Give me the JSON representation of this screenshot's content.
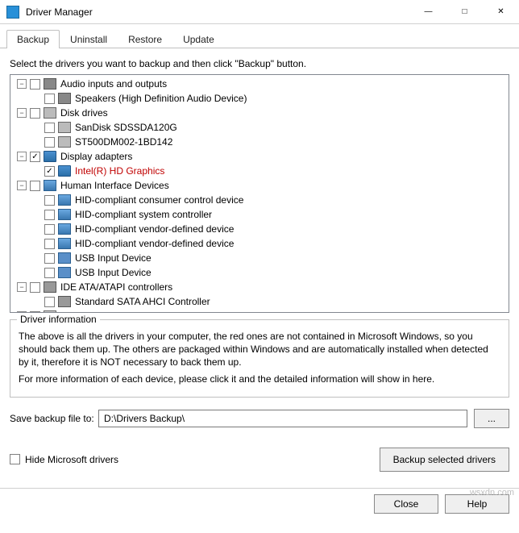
{
  "title": "Driver Manager",
  "tabs": [
    "Backup",
    "Uninstall",
    "Restore",
    "Update"
  ],
  "active_tab": 0,
  "instruction": "Select the drivers you want to backup and then click \"Backup\" button.",
  "tree": [
    {
      "level": 0,
      "expander": "-",
      "checked": false,
      "icon": "speaker",
      "label": "Audio inputs and outputs"
    },
    {
      "level": 1,
      "expander": "",
      "checked": false,
      "icon": "speaker",
      "label": "Speakers (High Definition Audio Device)"
    },
    {
      "level": 0,
      "expander": "-",
      "checked": false,
      "icon": "disk",
      "label": "Disk drives"
    },
    {
      "level": 1,
      "expander": "",
      "checked": false,
      "icon": "disk",
      "label": "SanDisk SDSSDA120G"
    },
    {
      "level": 1,
      "expander": "",
      "checked": false,
      "icon": "disk",
      "label": "ST500DM002-1BD142"
    },
    {
      "level": 0,
      "expander": "-",
      "checked": true,
      "icon": "monitor",
      "label": "Display adapters"
    },
    {
      "level": 1,
      "expander": "",
      "checked": true,
      "icon": "monitor",
      "label": "Intel(R) HD Graphics",
      "red": true
    },
    {
      "level": 0,
      "expander": "-",
      "checked": false,
      "icon": "hid",
      "label": "Human Interface Devices"
    },
    {
      "level": 1,
      "expander": "",
      "checked": false,
      "icon": "hid",
      "label": "HID-compliant consumer control device"
    },
    {
      "level": 1,
      "expander": "",
      "checked": false,
      "icon": "hid",
      "label": "HID-compliant system controller"
    },
    {
      "level": 1,
      "expander": "",
      "checked": false,
      "icon": "hid",
      "label": "HID-compliant vendor-defined device"
    },
    {
      "level": 1,
      "expander": "",
      "checked": false,
      "icon": "hid",
      "label": "HID-compliant vendor-defined device"
    },
    {
      "level": 1,
      "expander": "",
      "checked": false,
      "icon": "usb",
      "label": "USB Input Device"
    },
    {
      "level": 1,
      "expander": "",
      "checked": false,
      "icon": "usb",
      "label": "USB Input Device"
    },
    {
      "level": 0,
      "expander": "-",
      "checked": false,
      "icon": "ide",
      "label": "IDE ATA/ATAPI controllers"
    },
    {
      "level": 1,
      "expander": "",
      "checked": false,
      "icon": "ide",
      "label": "Standard SATA AHCI Controller"
    },
    {
      "level": 0,
      "expander": "-",
      "checked": false,
      "icon": "keyboard",
      "label": "Keyboards"
    }
  ],
  "info": {
    "legend": "Driver information",
    "para1": "The above is all the drivers in your computer, the red ones are not contained in Microsoft Windows, so you should back them up. The others are packaged within Windows and are automatically installed when detected by it, therefore it is NOT necessary to back them up.",
    "para2": "For more information of each device, please click it and the detailed information will show in here."
  },
  "save_label": "Save backup file to:",
  "save_path": "D:\\Drivers Backup\\",
  "browse_label": "...",
  "hide_label": "Hide Microsoft drivers",
  "backup_button": "Backup selected drivers",
  "close_button": "Close",
  "help_button": "Help",
  "watermark": "wsxdn.com"
}
